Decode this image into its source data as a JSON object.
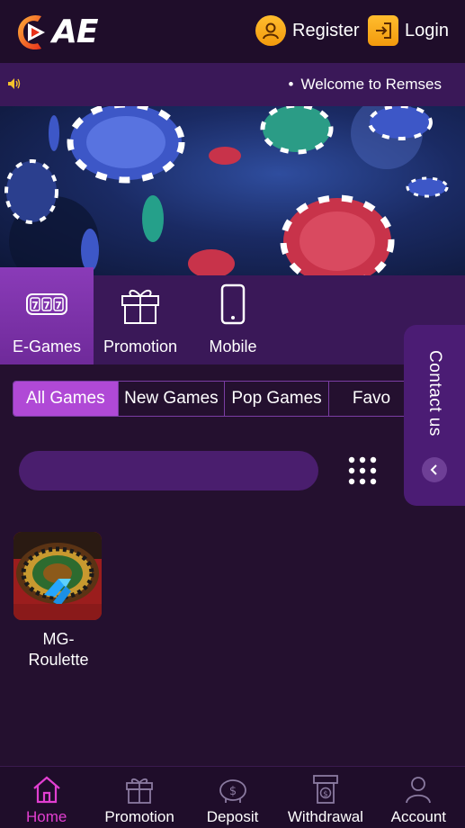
{
  "header": {
    "logo_text": "AE",
    "register_label": "Register",
    "login_label": "Login"
  },
  "marquee": {
    "text": "Welcome to Remses"
  },
  "categories": [
    {
      "label": "E-Games",
      "icon": "slot-777-icon",
      "active": true
    },
    {
      "label": "Promotion",
      "icon": "gift-icon",
      "active": false
    },
    {
      "label": "Mobile",
      "icon": "mobile-phone-icon",
      "active": false
    }
  ],
  "subtabs": [
    {
      "label": "All Games",
      "active": true
    },
    {
      "label": "New Games",
      "active": false
    },
    {
      "label": "Pop Games",
      "active": false
    },
    {
      "label": "Favo",
      "active": false
    }
  ],
  "search": {
    "placeholder": ""
  },
  "contact": {
    "label": "Contact us"
  },
  "games": [
    {
      "name": "MG-Roulette",
      "name_line1": "MG-",
      "name_line2": "Roulette"
    }
  ],
  "bottom_nav": [
    {
      "label": "Home",
      "icon": "home-icon",
      "active": true
    },
    {
      "label": "Promotion",
      "icon": "gift-icon",
      "active": false
    },
    {
      "label": "Deposit",
      "icon": "piggy-bank-icon",
      "active": false
    },
    {
      "label": "Withdrawal",
      "icon": "atm-withdraw-icon",
      "active": false
    },
    {
      "label": "Account",
      "icon": "user-icon",
      "active": false
    }
  ],
  "colors": {
    "background": "#24102f",
    "accent": "#b049d6",
    "active_nav": "#e23fd1",
    "header_button": "#f39a0d"
  }
}
